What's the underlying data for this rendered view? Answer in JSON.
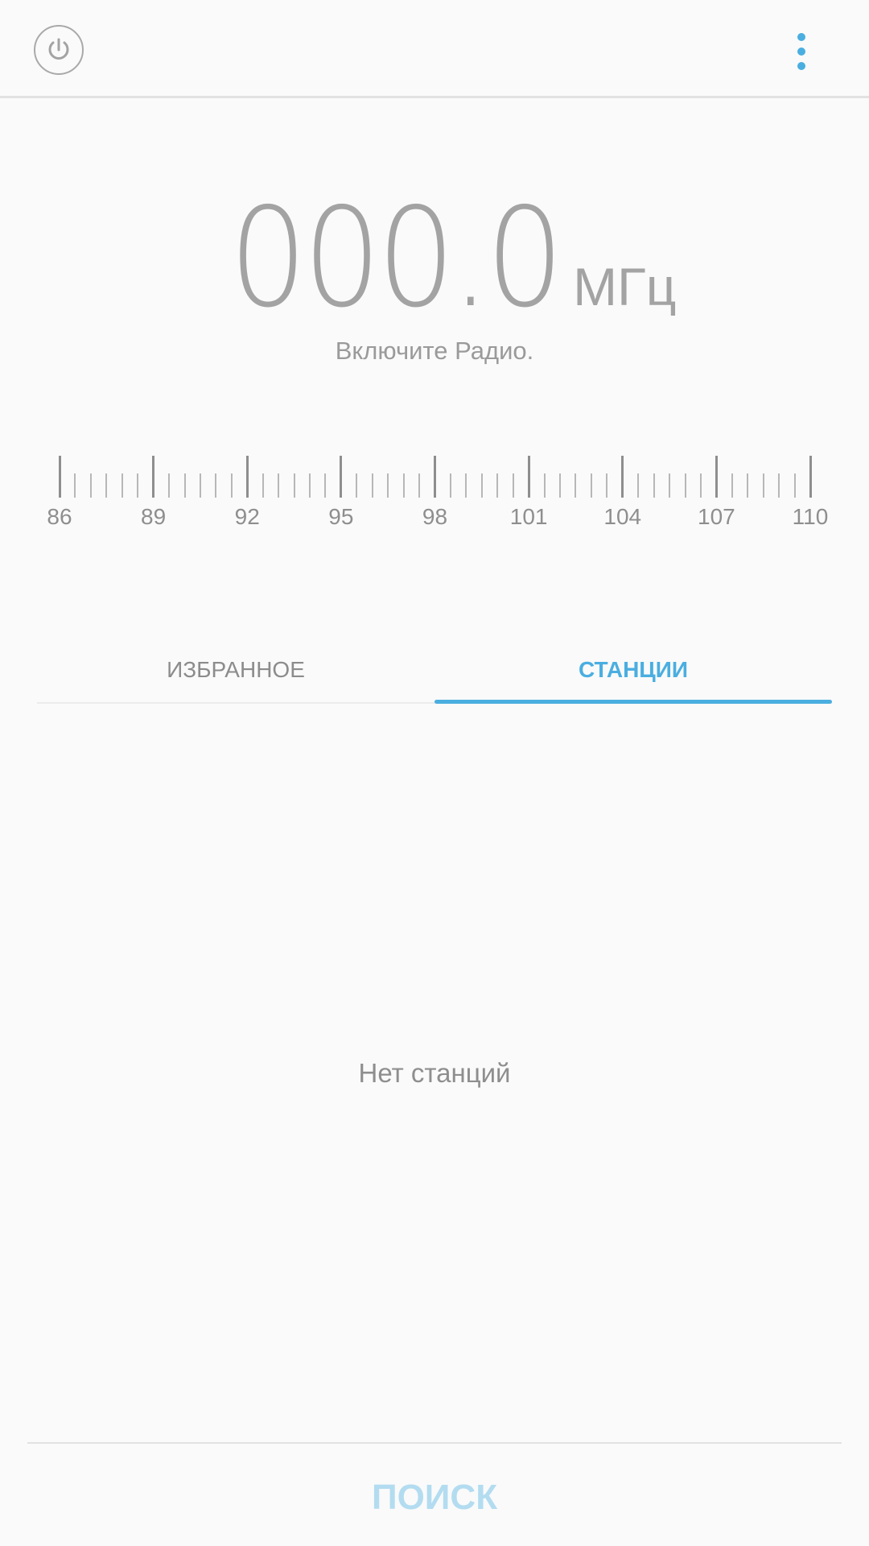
{
  "colors": {
    "accent": "#4aaee0",
    "accent_disabled": "#b3dcf0",
    "text_gray": "#a3a3a3",
    "background": "#fafafa"
  },
  "topbar": {
    "power_icon": "power-icon",
    "more_icon": "more-vertical-icon"
  },
  "frequency": {
    "value": "000.0",
    "unit": "МГц",
    "hint": "Включите Радио."
  },
  "scale": {
    "min": 86,
    "max": 110,
    "labels": [
      "86",
      "89",
      "92",
      "95",
      "98",
      "101",
      "104",
      "107",
      "110"
    ]
  },
  "tabs": {
    "items": [
      {
        "label": "ИЗБРАННОЕ",
        "selected": false
      },
      {
        "label": "СТАНЦИИ",
        "selected": true
      }
    ]
  },
  "stations": {
    "empty_text": "Нет станций"
  },
  "actions": {
    "search_label": "ПОИСК",
    "search_enabled": false
  }
}
